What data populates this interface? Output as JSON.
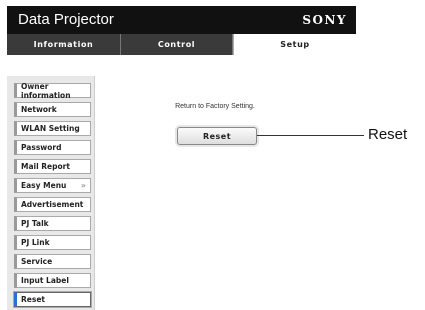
{
  "header": {
    "title": "Data Projector",
    "brand": "SONY"
  },
  "tabs": [
    {
      "label": "Information",
      "active": false
    },
    {
      "label": "Control",
      "active": false
    },
    {
      "label": "Setup",
      "active": true
    }
  ],
  "sidebar": {
    "items": [
      {
        "label": "Owner information"
      },
      {
        "label": "Network"
      },
      {
        "label": "WLAN Setting"
      },
      {
        "label": "Password"
      },
      {
        "label": "Mail Report"
      },
      {
        "label": "Easy Menu",
        "icon": "double-chevron-up-icon"
      },
      {
        "label": "Advertisement"
      },
      {
        "label": "PJ Talk"
      },
      {
        "label": "PJ Link"
      },
      {
        "label": "Service"
      },
      {
        "label": "Input Label"
      },
      {
        "label": "Reset",
        "selected": true
      }
    ]
  },
  "main": {
    "message": "Return to Factory Setting.",
    "reset_button_label": "Reset"
  },
  "callout": {
    "label": "Reset"
  }
}
